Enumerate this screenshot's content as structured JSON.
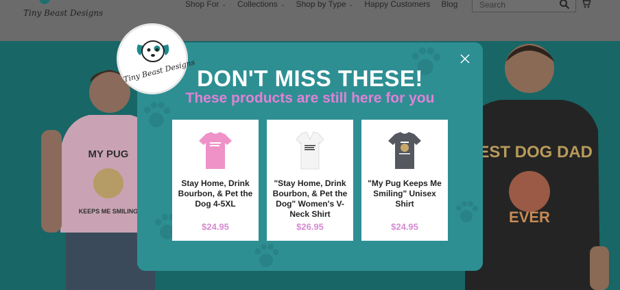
{
  "header": {
    "logo_text": "Tiny Beast Designs",
    "nav": [
      {
        "label": "Shop For",
        "has_dropdown": true
      },
      {
        "label": "Collections",
        "has_dropdown": true
      },
      {
        "label": "Shop by Type",
        "has_dropdown": true
      },
      {
        "label": "Happy Customers",
        "has_dropdown": false
      },
      {
        "label": "Blog",
        "has_dropdown": false
      }
    ],
    "search_placeholder": "Search",
    "icons": {
      "search": "search-icon",
      "cart": "cart-icon",
      "chevron": "chevron-down-icon"
    }
  },
  "hero": {
    "left_shirt_text": "MY PUG KEEPS ME SMILING",
    "right_shirt_text": "BEST DOG DAD EVER"
  },
  "popup": {
    "logo_text": "Tiny Beast Designs",
    "headline": "DON'T MISS THESE!",
    "subheadline": "These products are still here for you",
    "close_icon": "close-icon",
    "products": [
      {
        "title": "Stay Home, Drink Bourbon, & Pet the Dog 4-5XL",
        "price": "$24.95",
        "color": "#ef92c8"
      },
      {
        "title": "\"Stay Home, Drink Bourbon, & Pet the Dog\" Women's V-Neck Shirt",
        "price": "$26.95",
        "color": "#f4f4f4"
      },
      {
        "title": "\"My Pug Keeps Me Smiling\" Unisex Shirt",
        "price": "$24.95",
        "color": "#55585e"
      }
    ]
  },
  "colors": {
    "teal_modal": "#2e8f93",
    "hero_teal": "#186666",
    "pink_accent": "#df82d6",
    "overlay_grey": "#5e5e5e"
  }
}
